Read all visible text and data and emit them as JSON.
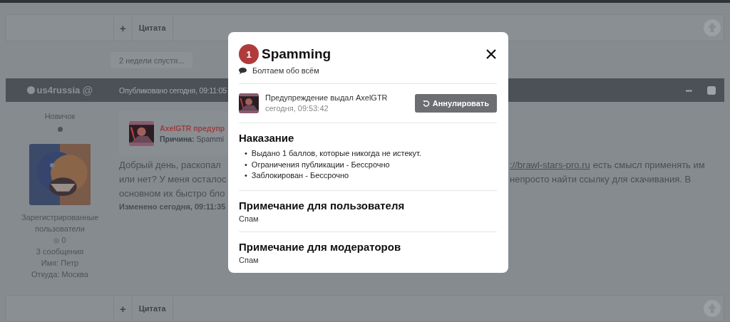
{
  "top_bar": {
    "add_label": "+",
    "quote_label": "Цитата"
  },
  "separator": "2 недели спустя...",
  "post": {
    "author": "us4russia",
    "author_online": false,
    "mention": "@",
    "published": "Опубликовано сегодня, 09:11:05",
    "more": "•••",
    "selected": false,
    "rank": "Новичок",
    "group": "Зарегистрированные пользователи",
    "reputation": "0",
    "posts": "3 сообщения",
    "name": "Имя: Петр",
    "location": "Откуда: Москва",
    "warning": {
      "title": "AxelGTR предупр",
      "reason": "**Причина:** Spammi"
    },
    "body_lines": [
      {
        "left": "Добрый день, раскопал",
        "link": "://brawl-stars-pro.ru",
        "right": "есть смысл применять им"
      },
      {
        "left": "или нет? У меня осталос",
        "right": "непросто найти ссылку для скачивания. В"
      },
      {
        "left": "основном их быстро бло"
      }
    ],
    "edited": "Изменено сегодня, 09:11:35"
  },
  "bottom_bar": {
    "add_label": "+",
    "quote_label": "Цитата"
  },
  "modal": {
    "points": "1",
    "title": "Spamming",
    "forum": "Болтаем обо всём",
    "issuer": "Предупреждение выдал AxelGTR",
    "issued_at": "сегодня, 09:53:42",
    "revoke_button": "Аннулировать",
    "sections": [
      {
        "kind": "list",
        "heading": "Наказание",
        "marker": "•",
        "items": [
          "Выдано 1 баллов, которые никогда не истекут.",
          "Ограничения публикации - Бессрочно",
          "Заблокирован - Бессрочно"
        ]
      },
      {
        "kind": "note",
        "heading": "Примечание для пользователя",
        "text": "Спам"
      },
      {
        "kind": "note",
        "heading": "Примечание для модераторов",
        "text": "Спам"
      }
    ]
  }
}
